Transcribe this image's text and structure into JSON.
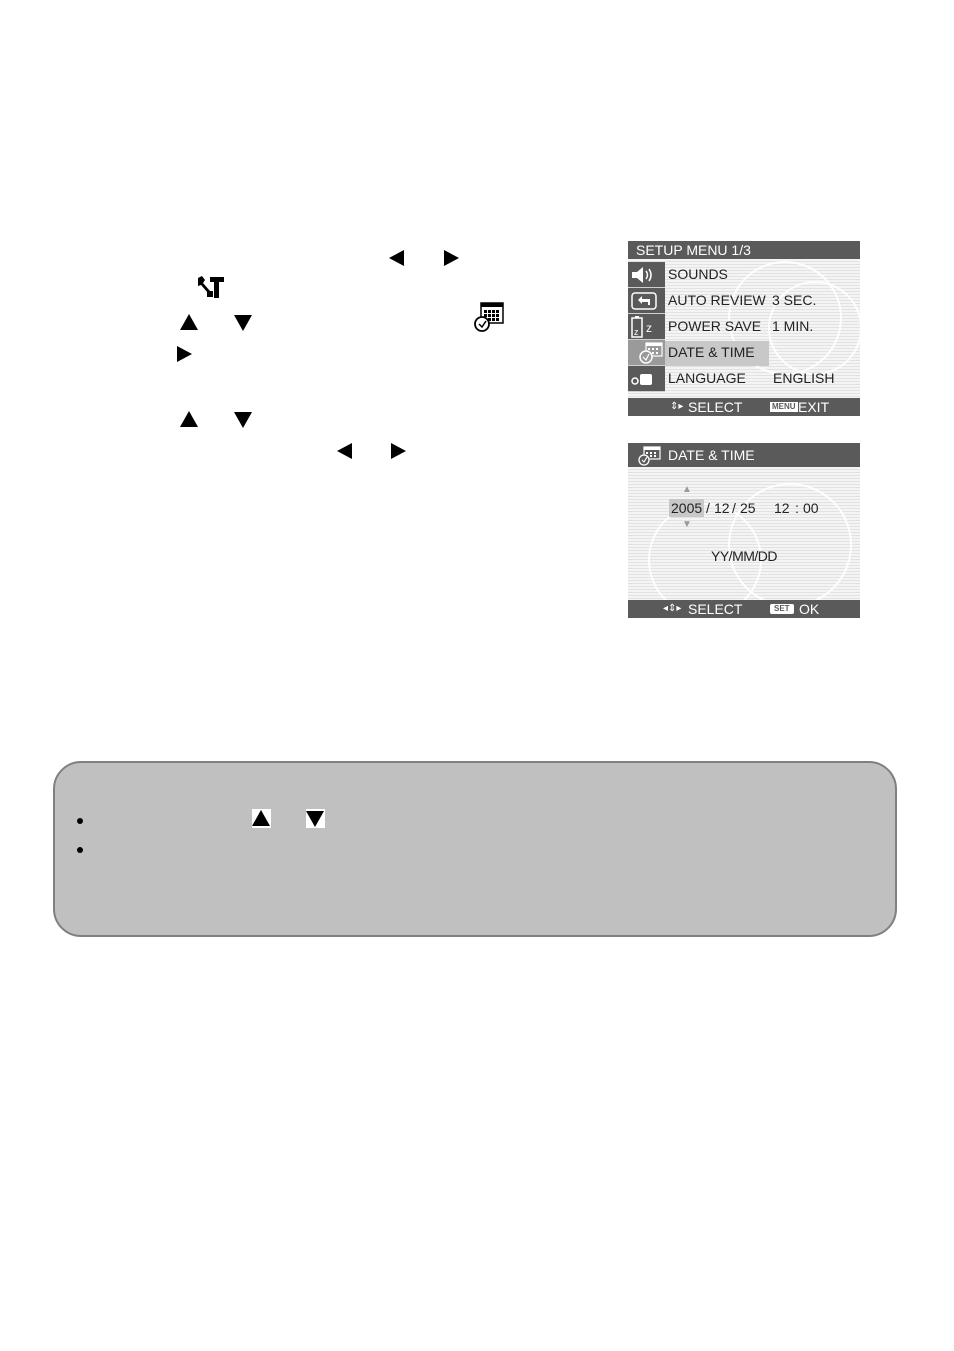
{
  "instructions": {
    "icons": [
      "left-arrow",
      "right-arrow",
      "setup-wrench-hammer",
      "up-arrow",
      "down-arrow",
      "date-time-calendar-clock",
      "right-arrow",
      "up-arrow",
      "down-arrow",
      "left-arrow",
      "right-arrow"
    ]
  },
  "setup_menu": {
    "title": "SETUP MENU 1/3",
    "items": [
      {
        "label": "SOUNDS",
        "value": "",
        "icon": "speaker-icon"
      },
      {
        "label": "AUTO REVIEW",
        "value": "3 SEC.",
        "icon": "review-arrow-icon"
      },
      {
        "label": "POWER SAVE",
        "value": "1 MIN.",
        "icon": "battery-sleep-icon"
      },
      {
        "label": "DATE & TIME",
        "value": "",
        "icon": "calendar-clock-icon",
        "selected": true
      },
      {
        "label": "LANGUAGE",
        "value": "ENGLISH",
        "icon": "language-icon"
      }
    ],
    "footer": {
      "select": "SELECT",
      "menu_key": "MENU",
      "exit": "EXIT"
    }
  },
  "date_time_screen": {
    "title": "DATE & TIME",
    "year": "2005",
    "sep1": "/",
    "month": "12",
    "sep2": "/",
    "day": "25",
    "hour": "12",
    "colon": ":",
    "minute": "00",
    "format": "YY/MM/DD",
    "footer": {
      "select": "SELECT",
      "set_key": "SET",
      "ok": "OK"
    }
  },
  "note_box": {
    "bullets": 2,
    "icons": [
      "up-arrow",
      "down-arrow"
    ]
  }
}
